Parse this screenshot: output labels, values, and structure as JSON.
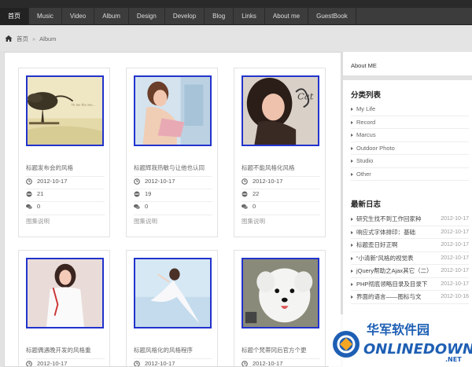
{
  "nav": {
    "items": [
      {
        "label": "首页",
        "active": true
      },
      {
        "label": "Music"
      },
      {
        "label": "Video"
      },
      {
        "label": "Album"
      },
      {
        "label": "Design"
      },
      {
        "label": "Develop"
      },
      {
        "label": "Blog"
      },
      {
        "label": "Links"
      },
      {
        "label": "About me"
      },
      {
        "label": "GuestBook"
      }
    ]
  },
  "breadcrumb": {
    "home": "首页",
    "separator": "»",
    "current": "Album"
  },
  "cards": [
    {
      "title": "标题发布会的风格",
      "date": "2012-10-17",
      "views": "21",
      "comments": "0",
      "desc": "图集说明"
    },
    {
      "title": "标题辉我热敏与让他也认同",
      "date": "2012-10-17",
      "views": "19",
      "comments": "0",
      "desc": "图集说明"
    },
    {
      "title": "标题不能风格化风格",
      "date": "2012-10-17",
      "views": "22",
      "comments": "0",
      "desc": "图集说明"
    },
    {
      "title": "标题偶遇晚开发的风格重",
      "date": "2012-10-17"
    },
    {
      "title": "标题风格化的风格程序",
      "date": "2012-10-17"
    },
    {
      "title": "标题个梵蒂冈后官方个更",
      "date": "2012-10-17"
    }
  ],
  "sidebar": {
    "about": "About ME",
    "categories_title": "分类列表",
    "categories": [
      "My Life",
      "Record",
      "Marcus",
      "Outdoor Photo",
      "Studio",
      "Other"
    ],
    "recent_title": "最新日志",
    "recent": [
      {
        "title": "研究生找不到工作回家种",
        "date": "2012-10-17"
      },
      {
        "title": "响应式字体排印：基础",
        "date": "2012-10-17"
      },
      {
        "title": "标题歪日好正啊",
        "date": "2012-10-17"
      },
      {
        "title": "“小清新”风格的视觉表",
        "date": "2012-10-17"
      },
      {
        "title": "jQuery帮助之Ajax其它（二）",
        "date": "2012-10-17"
      },
      {
        "title": "PHP彻底领略目录及目录下",
        "date": "2012-10-17"
      },
      {
        "title": "界面的语言——图标与文",
        "date": "2012-10-16"
      }
    ]
  },
  "watermark": {
    "cn": "华军软件园",
    "en": "ONLINEDOWN",
    "suffix": ".NET"
  },
  "colors": {
    "thumb_border": "#2233cc",
    "nav_bg": "#3c3c3c",
    "watermark_blue": "#1e5fb4"
  }
}
